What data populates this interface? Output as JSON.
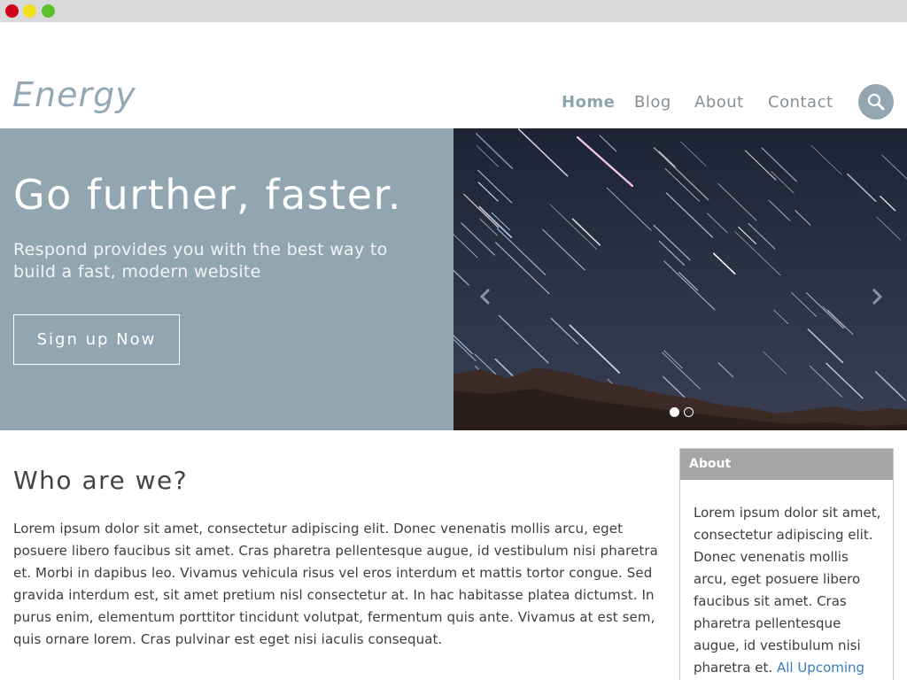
{
  "window": {
    "controls": [
      "close",
      "minimize",
      "maximize"
    ]
  },
  "header": {
    "logo": "Energy",
    "nav": [
      {
        "label": "Home",
        "active": true
      },
      {
        "label": "Blog",
        "active": false
      },
      {
        "label": "About",
        "active": false
      },
      {
        "label": "Contact",
        "active": false
      }
    ],
    "search_icon": "search-icon"
  },
  "hero": {
    "title": "Go further, faster.",
    "subtitle": "Respond provides you with the best way to build a fast, modern website",
    "cta": "Sign up Now"
  },
  "slider": {
    "slides": 2,
    "active_slide": 1,
    "prev_icon": "chevron-left-icon",
    "next_icon": "chevron-right-icon"
  },
  "main": {
    "heading": "Who are we?",
    "body": "Lorem ipsum dolor sit amet, consectetur adipiscing elit. Donec venenatis mollis arcu, eget posuere libero faucibus sit amet. Cras pharetra pellentesque augue, id vestibulum nisi pharetra et. Morbi in dapibus leo. Vivamus vehicula risus vel eros interdum et mattis tortor congue. Sed gravida interdum est, sit amet pretium nisl consectetur at. In hac habitasse platea dictumst. In purus enim, elementum porttitor tincidunt volutpat, fermentum quis ante. Vivamus at est sem, quis ornare lorem. Cras pulvinar est eget nisi iaculis consequat."
  },
  "sidebar": {
    "title": "About",
    "body": "Lorem ipsum dolor sit amet, consectetur adipiscing elit. Donec venenatis mollis arcu, eget posuere libero faucibus sit amet. Cras pharetra pellentesque augue, id vestibulum nisi pharetra et.",
    "link": "All Upcoming"
  },
  "colors": {
    "accent": "#92a6b2",
    "sidebar_header": "#a5a5a5",
    "link": "#3a7dbf"
  }
}
